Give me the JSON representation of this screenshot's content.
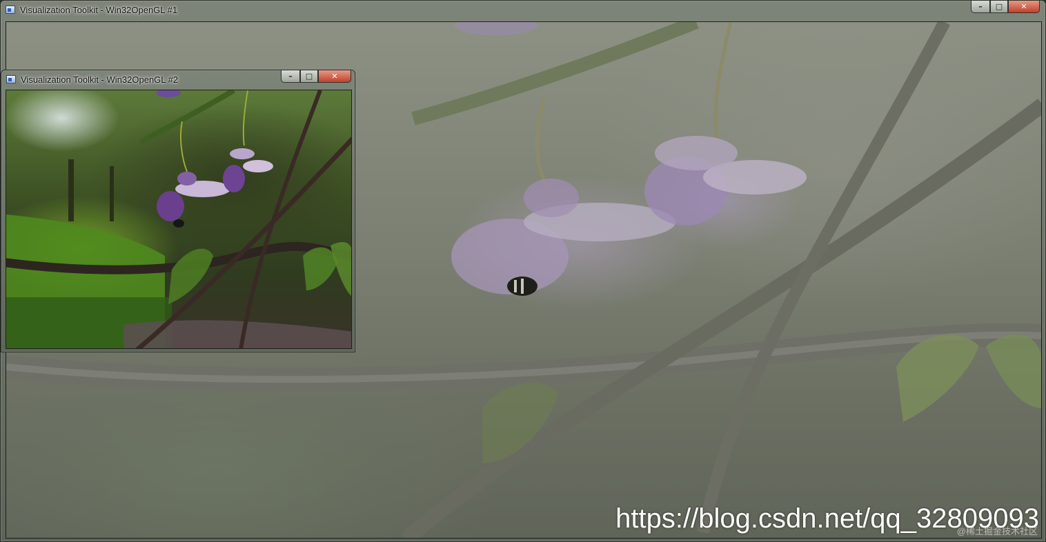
{
  "window1": {
    "title": "Visualization Toolkit - Win32OpenGL #1",
    "minimize_glyph": "–",
    "maximize_glyph": "□",
    "close_glyph": "✕"
  },
  "window2": {
    "title": "Visualization Toolkit - Win32OpenGL #2",
    "minimize_glyph": "–",
    "maximize_glyph": "□",
    "close_glyph": "✕"
  },
  "watermark": {
    "url": "https://blog.csdn.net/qq_32809093",
    "sub": "@稀土掘金技术社区"
  },
  "icons": {
    "app": "vtk-window-icon",
    "minimize": "minimize-icon",
    "maximize": "maximize-icon",
    "close": "close-icon"
  },
  "colors": {
    "close_button": "#c2402a",
    "frame": "#5d6459",
    "flower": "#7a5aa8"
  }
}
